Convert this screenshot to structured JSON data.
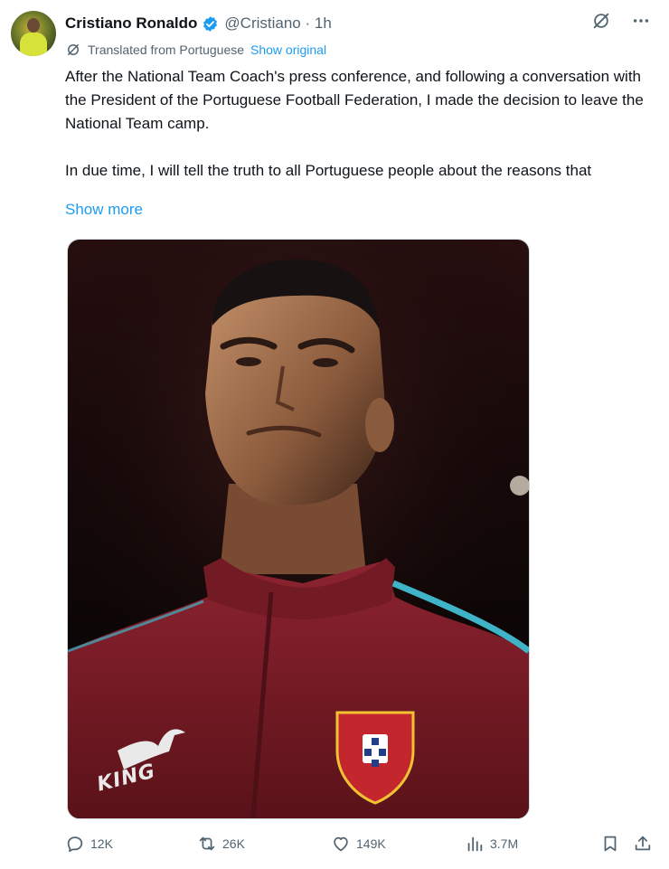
{
  "author": {
    "name": "Cristiano Ronaldo",
    "handle": "@Cristiano",
    "separator": "·",
    "time": "1h"
  },
  "translation": {
    "label": "Translated from Portuguese",
    "show_original": "Show original"
  },
  "post": {
    "paragraph1": "After the National Team Coach's press conference, and following a conversation with the President of the Portuguese Football Federation, I made the decision to leave the National Team camp.",
    "paragraph2": "In due time, I will tell the truth to all Portuguese people about the reasons that",
    "show_more": "Show more"
  },
  "media": {
    "jersey_text": "KING"
  },
  "actions": {
    "replies": "12K",
    "reposts": "26K",
    "likes": "149K",
    "views": "3.7M"
  },
  "colors": {
    "accent": "#1d9bf0",
    "secondary_text": "#536471",
    "jersey": "#7a1b22",
    "jersey_trim": "#3fb3c7"
  },
  "icons": [
    "verified-badge-icon",
    "grok-icon",
    "more-icon",
    "translate-icon",
    "reply-icon",
    "repost-icon",
    "like-icon",
    "views-icon",
    "bookmark-icon",
    "share-icon"
  ]
}
